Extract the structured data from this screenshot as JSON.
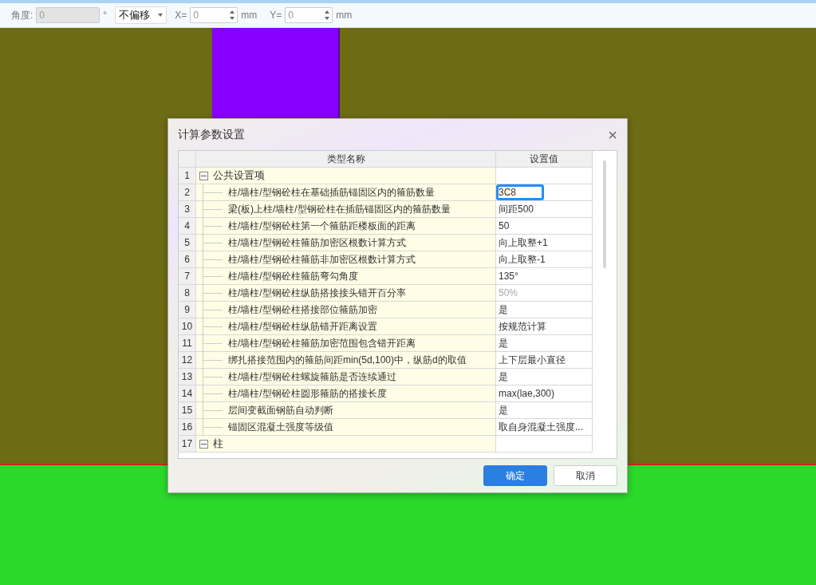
{
  "toolbar": {
    "angle_label": "角度:",
    "angle_value": "0",
    "angle_disabled": true,
    "degree_unit": "°",
    "offset_select": "不偏移",
    "x_label": "X=",
    "x_value": "0",
    "x_unit": "mm",
    "y_label": "Y=",
    "y_value": "0",
    "y_unit": "mm"
  },
  "dialog": {
    "title": "计算参数设置",
    "close": "×",
    "columns": [
      "类型名称",
      "设置值"
    ],
    "rows": [
      {
        "num": "1",
        "kind": "group",
        "expanded": true,
        "name": "公共设置项",
        "selected": false
      },
      {
        "num": "2",
        "kind": "item",
        "name": "柱/墙柱/型钢砼柱在基础插筋锚固区内的箍筋数量",
        "value": "3C8",
        "selected": true,
        "disabled": false
      },
      {
        "num": "3",
        "kind": "item",
        "name": "梁(板)上柱/墙柱/型钢砼柱在插筋锚固区内的箍筋数量",
        "value": "间距500",
        "selected": false,
        "disabled": false
      },
      {
        "num": "4",
        "kind": "item",
        "name": "柱/墙柱/型钢砼柱第一个箍筋距楼板面的距离",
        "value": "50",
        "selected": false,
        "disabled": false
      },
      {
        "num": "5",
        "kind": "item",
        "name": "柱/墙柱/型钢砼柱箍筋加密区根数计算方式",
        "value": "向上取整+1",
        "selected": false,
        "disabled": false
      },
      {
        "num": "6",
        "kind": "item",
        "name": "柱/墙柱/型钢砼柱箍筋非加密区根数计算方式",
        "value": "向上取整-1",
        "selected": false,
        "disabled": false
      },
      {
        "num": "7",
        "kind": "item",
        "name": "柱/墙柱/型钢砼柱箍筋弯勾角度",
        "value": "135°",
        "selected": false,
        "disabled": false
      },
      {
        "num": "8",
        "kind": "item",
        "name": "柱/墙柱/型钢砼柱纵筋搭接接头错开百分率",
        "value": "50%",
        "selected": false,
        "disabled": true
      },
      {
        "num": "9",
        "kind": "item",
        "name": "柱/墙柱/型钢砼柱搭接部位箍筋加密",
        "value": "是",
        "selected": false,
        "disabled": false
      },
      {
        "num": "10",
        "kind": "item",
        "name": "柱/墙柱/型钢砼柱纵筋错开距离设置",
        "value": "按规范计算",
        "selected": false,
        "disabled": false
      },
      {
        "num": "11",
        "kind": "item",
        "name": "柱/墙柱/型钢砼柱箍筋加密范围包含错开距离",
        "value": "是",
        "selected": false,
        "disabled": false
      },
      {
        "num": "12",
        "kind": "item",
        "name": "绑扎搭接范围内的箍筋间距min(5d,100)中，纵筋d的取值",
        "value": "上下层最小直径",
        "selected": false,
        "disabled": false
      },
      {
        "num": "13",
        "kind": "item",
        "name": "柱/墙柱/型钢砼柱螺旋箍筋是否连续通过",
        "value": "是",
        "selected": false,
        "disabled": false
      },
      {
        "num": "14",
        "kind": "item",
        "name": "柱/墙柱/型钢砼柱圆形箍筋的搭接长度",
        "value": "max(lae,300)",
        "selected": false,
        "disabled": false
      },
      {
        "num": "15",
        "kind": "item",
        "name": "层间变截面钢筋自动判断",
        "value": "是",
        "selected": false,
        "disabled": false
      },
      {
        "num": "16",
        "kind": "item",
        "name": "锚固区混凝土强度等级值",
        "value": "取自身混凝土强度...",
        "selected": false,
        "disabled": false
      },
      {
        "num": "17",
        "kind": "group",
        "expanded": true,
        "name": "柱",
        "selected": false
      }
    ],
    "buttons": [
      {
        "label": "确定",
        "primary": true
      },
      {
        "label": "取消",
        "primary": false
      }
    ]
  }
}
